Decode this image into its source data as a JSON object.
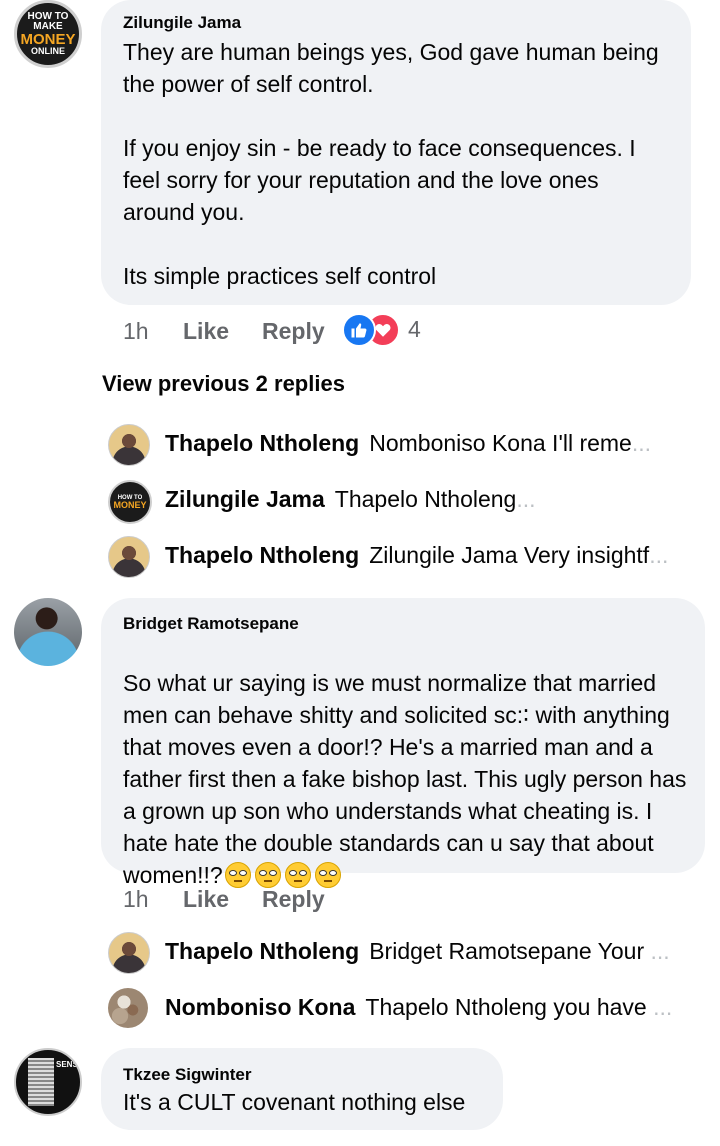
{
  "comments": [
    {
      "author": "Zilungile Jama",
      "avatar_text": [
        "HOW TO",
        "MAKE",
        "MONEY",
        "ONLINE"
      ],
      "text": "They are human beings yes, God gave human being the power of self control.\n\nIf you enjoy sin - be ready to face consequences. I feel sorry for your reputation and the love ones around you.\n\nIts simple practices self control",
      "time": "1h",
      "like": "Like",
      "reply": "Reply",
      "reaction_count": "4",
      "reaction_icons": [
        "like-icon",
        "love-icon"
      ]
    },
    {
      "author": "Bridget Ramotsepane",
      "text": "So what ur saying is we must normalize that married men can behave shitty and solicited sс:∶ with anything that moves even a door!? He's a married man and a father first then a fake bishop last. This ugly person has a grown up son who understands what cheating is. I hate hate the double standards can u say that about women!!?",
      "emoji_count": 4,
      "emoji_icon": "rolling-eyes-emoji-icon",
      "time": "1h",
      "like": "Like",
      "reply": "Reply"
    },
    {
      "author": "Tkzee Sigwinter",
      "avatar_text": "SENSE",
      "text": "It's a CULT covenant nothing else"
    }
  ],
  "view_previous": "View previous 2 replies",
  "replies_1": [
    {
      "name": "Thapelo Ntholeng",
      "text": "Nomboniso Kona I'll reme",
      "ellipsis": "..."
    },
    {
      "name": "Zilungile Jama",
      "text": "Thapelo Ntholeng",
      "ellipsis": "..."
    },
    {
      "name": "Thapelo Ntholeng",
      "text": "Zilungile Jama Very insightf",
      "ellipsis": "..."
    }
  ],
  "replies_2": [
    {
      "name": "Thapelo Ntholeng",
      "text": "Bridget Ramotsepane Your",
      "ellipsis": "..."
    },
    {
      "name": "Nomboniso Kona",
      "text": "Thapelo Ntholeng you have",
      "ellipsis": "..."
    }
  ],
  "colors": {
    "bubble": "#f0f2f5",
    "meta": "#65676b",
    "like_blue": "#1877f2",
    "love_red": "#f33e58"
  }
}
